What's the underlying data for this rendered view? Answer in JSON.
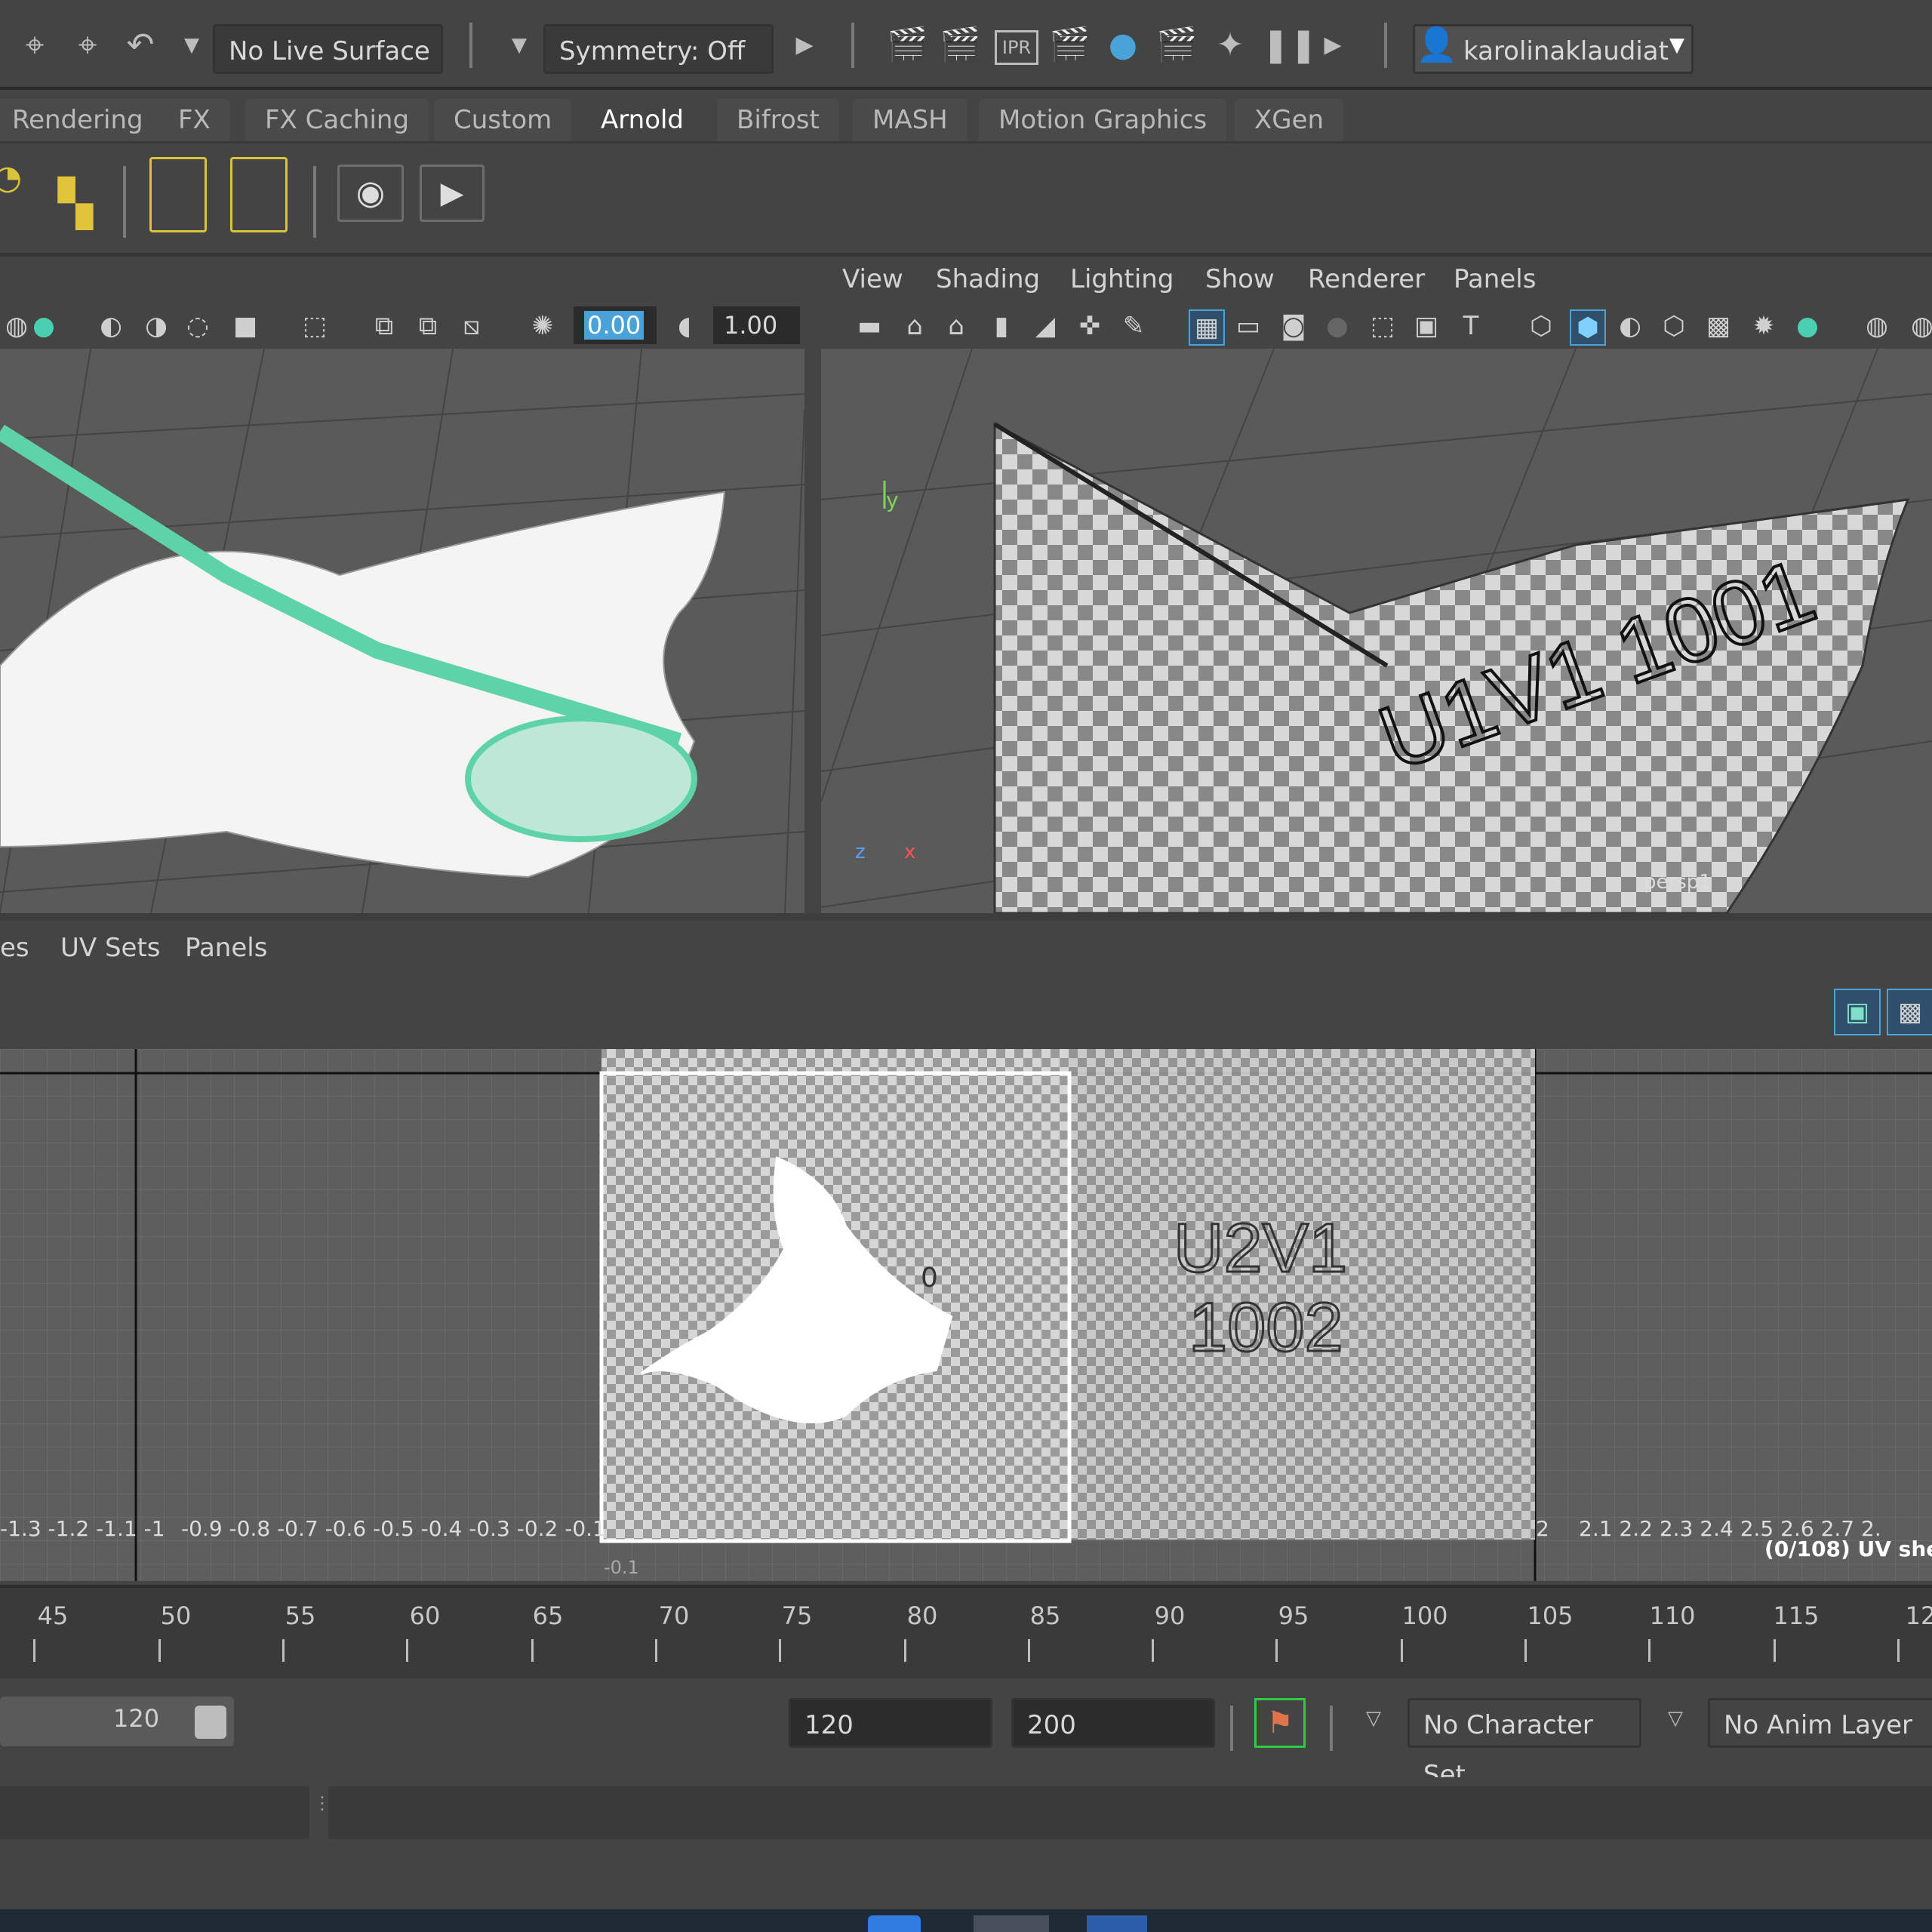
{
  "status_line": {
    "live_surface": "No Live Surface",
    "symmetry": "Symmetry: Off",
    "user": "karolinaklaudiat"
  },
  "shelf_tabs": [
    "Rendering",
    "FX",
    "FX Caching",
    "Custom",
    "Arnold",
    "Bifrost",
    "MASH",
    "Motion Graphics",
    "XGen"
  ],
  "active_shelf_tab": "Arnold",
  "viewport_menu": [
    "View",
    "Shading",
    "Lighting",
    "Show",
    "Renderer",
    "Panels"
  ],
  "viewport_fields": {
    "exposure": "0.00",
    "gamma": "1.00"
  },
  "viewport_right": {
    "camera_label": "persp1",
    "axes": {
      "y": "y",
      "z": "z",
      "x": "x"
    }
  },
  "right_viewport_text": "U1V1 1001",
  "uv_editor": {
    "menu": [
      "es",
      "UV Sets",
      "Panels"
    ],
    "tile_label_top": "U2V1",
    "tile_label_bottom": "1002",
    "tile_badge": "0",
    "left_ticks": "-1.3 -1.2 -1.1 -1",
    "neg_ticks": "-0.9 -0.8 -0.7 -0.6 -0.5 -0.4 -0.3 -0.2 -0.1",
    "right_ticks": "2.1 2.2 2.3 2.4 2.5 2.6 2.7 2.",
    "tick_two": "2",
    "below_tick": "-0.1",
    "uv_shell_info": "(0/108) UV she"
  },
  "time_slider": {
    "ticks": [
      "45",
      "50",
      "55",
      "60",
      "65",
      "70",
      "75",
      "80",
      "85",
      "90",
      "95",
      "100",
      "105",
      "110",
      "115",
      "12"
    ]
  },
  "range_slider": {
    "playback_end": "120",
    "anim_end": "120",
    "scene_end": "200",
    "character_set": "No Character Set",
    "anim_layer": "No Anim Layer"
  },
  "colors": {
    "accent": "#5fd3a8",
    "highlight": "#4aa3d8",
    "tab_bg": "#4a4a4a"
  }
}
